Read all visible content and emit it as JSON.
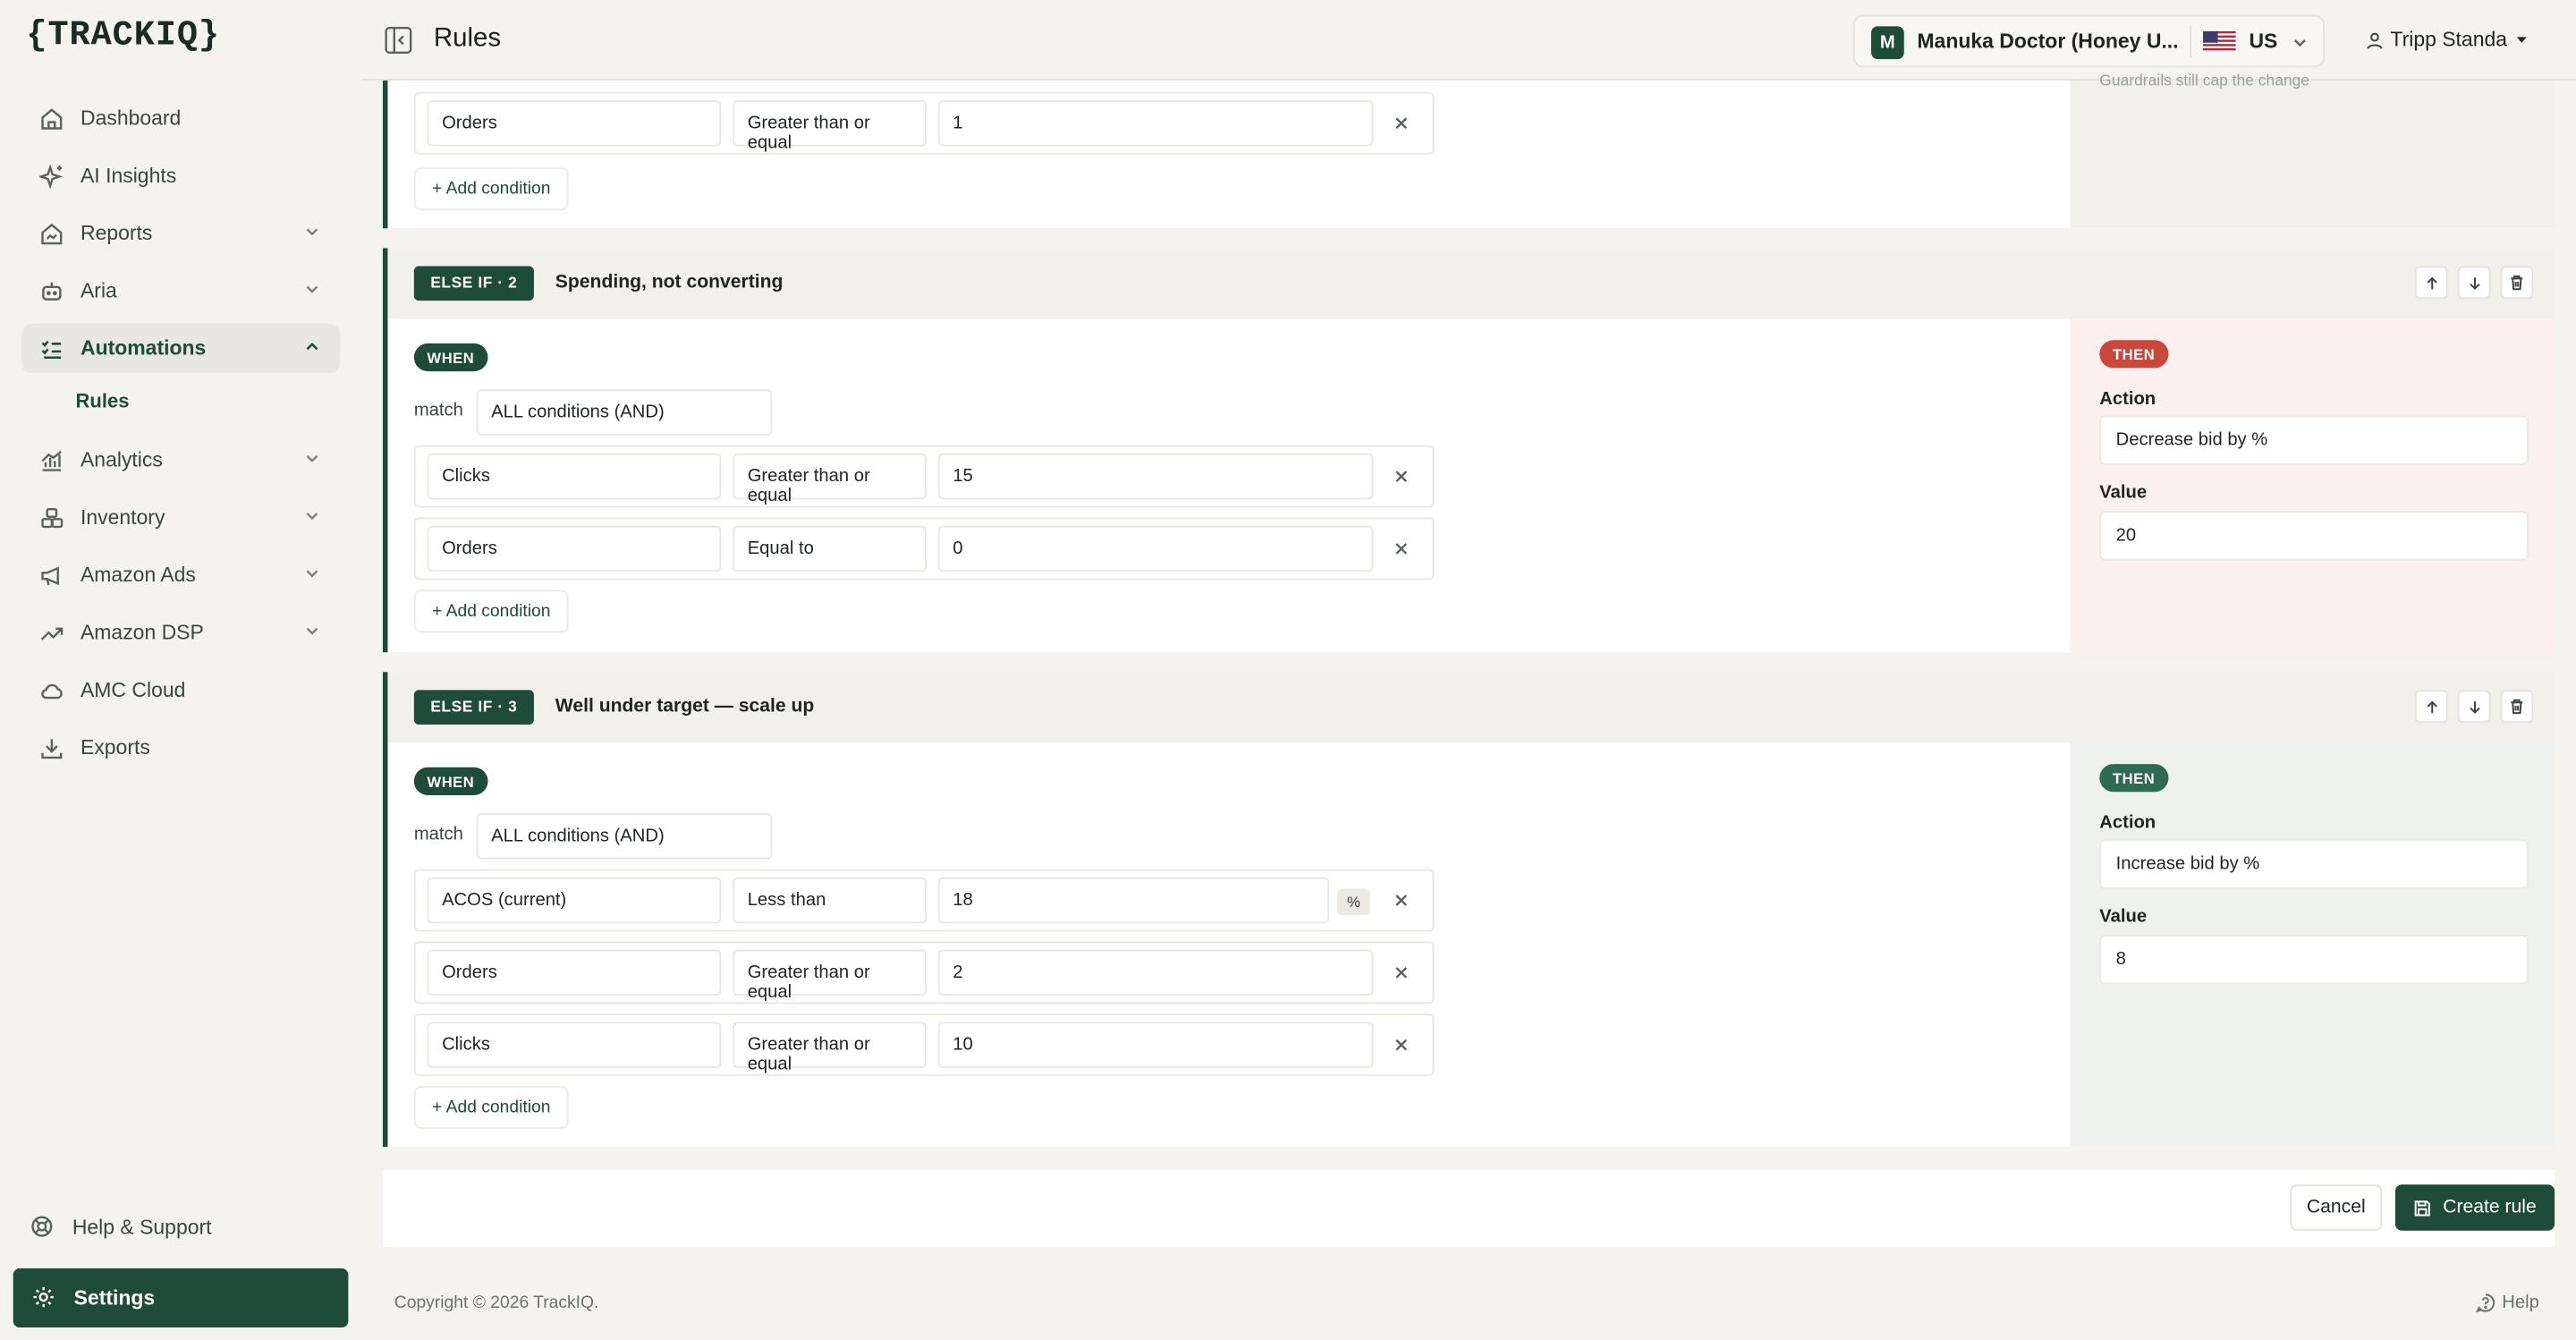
{
  "app": {
    "logo": "{TRACKIQ}",
    "page_title": "Rules"
  },
  "topbar": {
    "store_initial": "M",
    "store_name": "Manuka Doctor (Honey U...",
    "country": "US",
    "user": "Tripp Standa"
  },
  "sidebar": {
    "items": [
      {
        "label": "Dashboard"
      },
      {
        "label": "AI Insights"
      },
      {
        "label": "Reports"
      },
      {
        "label": "Aria"
      },
      {
        "label": "Automations"
      },
      {
        "label": "Analytics"
      },
      {
        "label": "Inventory"
      },
      {
        "label": "Amazon Ads"
      },
      {
        "label": "Amazon DSP"
      },
      {
        "label": "AMC Cloud"
      },
      {
        "label": "Exports"
      }
    ],
    "sub_rules": "Rules",
    "help": "Help & Support",
    "settings": "Settings"
  },
  "rules": {
    "partial": {
      "cond": {
        "field": "Orders",
        "op": "Greater than or equal",
        "value": "1"
      },
      "add": "+ Add condition",
      "note": "Guardrails still cap the change"
    },
    "r2": {
      "badge": "ELSE IF · 2",
      "name": "Spending, not converting",
      "when": "WHEN",
      "match_label": "match",
      "match": "ALL conditions (AND)",
      "conds": [
        {
          "field": "Clicks",
          "op": "Greater than or equal",
          "value": "15"
        },
        {
          "field": "Orders",
          "op": "Equal to",
          "value": "0"
        }
      ],
      "add": "+ Add condition",
      "then": "THEN",
      "action_label": "Action",
      "action": "Decrease bid by %",
      "value_label": "Value",
      "value": "20"
    },
    "r3": {
      "badge": "ELSE IF · 3",
      "name": "Well under target — scale up",
      "when": "WHEN",
      "match_label": "match",
      "match": "ALL conditions (AND)",
      "conds": [
        {
          "field": "ACOS (current)",
          "op": "Less than",
          "value": "18",
          "unit": "%"
        },
        {
          "field": "Orders",
          "op": "Greater than or equal",
          "value": "2"
        },
        {
          "field": "Clicks",
          "op": "Greater than or equal",
          "value": "10"
        }
      ],
      "add": "+ Add condition",
      "then": "THEN",
      "action_label": "Action",
      "action": "Increase bid by %",
      "value_label": "Value",
      "value": "8"
    }
  },
  "footer": {
    "cancel": "Cancel",
    "create": "Create rule",
    "copyright": "Copyright © 2026 TrackIQ.",
    "help": "Help"
  },
  "colors": {
    "brand": "#1f4b3b",
    "decrease": "#c9483c",
    "increase": "#2e6b52"
  }
}
